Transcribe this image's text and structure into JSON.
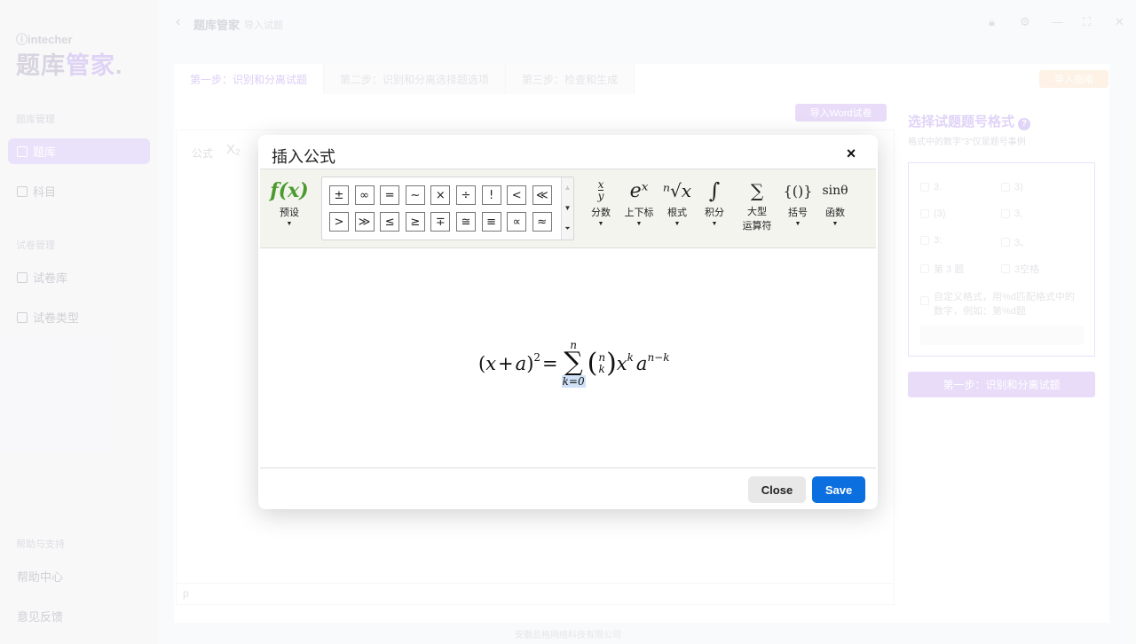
{
  "app": {
    "brand_small": "intecher",
    "brand_part1": "题库",
    "brand_part2": "管家",
    "brand_dot": ".",
    "title": "题库管家",
    "subtitle": "导入试题",
    "company": "安徽品格网络科技有限公司"
  },
  "sidebar": {
    "section_bank": "题库管理",
    "item_bank": "题库",
    "item_subject": "科目",
    "section_paper": "试卷管理",
    "item_paper_lib": "试卷库",
    "item_paper_type": "试卷类型",
    "section_help": "帮助与支持",
    "item_help": "帮助中心",
    "item_feedback": "意见反馈"
  },
  "steps": {
    "step1": "第一步：识别和分离试题",
    "step2": "第二步：识别和分离选择题选项",
    "step3": "第三步：检查和生成"
  },
  "buttons": {
    "import_guide": "导入指南",
    "import_word": "导入Word试卷"
  },
  "editor": {
    "tool_formula": "公式",
    "tool_subscript": "X₂",
    "status_tag": "p"
  },
  "right_panel": {
    "title": "选择试题题号格式",
    "help": "?",
    "subtitle": "格式中的数字\"3\"仅是题号事例",
    "options": [
      "3.",
      "3)",
      "(3)",
      "3,",
      "3:",
      "3、",
      "第 3 题",
      "3空格"
    ],
    "custom_option": "自定义格式，用%d匹配格式中的数字，例如：第%d题",
    "submit": "第一步：识别和分离试题"
  },
  "modal": {
    "title": "插入公式",
    "close_icon": "×",
    "preset_label": "预设",
    "preset_glyph": "f(x)",
    "symbols_row1": [
      "±",
      "∞",
      "=",
      "~",
      "×",
      "÷",
      "!",
      "<",
      "≪"
    ],
    "symbols_row2": [
      ">",
      "≫",
      "≤",
      "≥",
      "∓",
      "≅",
      "≡",
      "∝",
      "≈"
    ],
    "groups": [
      {
        "glyph": "x/y",
        "label": "分数"
      },
      {
        "glyph": "eˣ",
        "label": "上下标"
      },
      {
        "glyph": "ⁿ√x",
        "label": "根式"
      },
      {
        "glyph": "∫",
        "label": "积分"
      },
      {
        "glyph": "∑",
        "label": "大型\n运算符"
      },
      {
        "glyph": "{()}",
        "label": "括号"
      },
      {
        "glyph": "sinθ",
        "label": "函数"
      }
    ],
    "formula": {
      "lhs_open": "(",
      "x": "x",
      "plus": "+",
      "a": "a",
      "lhs_close": ")",
      "exp2": "2",
      "eq": "=",
      "sum_upper": "n",
      "sum_sign": "∑",
      "sum_lower": "k=0",
      "binom_top": "n",
      "binom_bottom": "k",
      "xk_base": "x",
      "xk_exp": "k",
      "a_base": "a",
      "a_exp": "n−k"
    },
    "close_button": "Close",
    "save_button": "Save"
  }
}
